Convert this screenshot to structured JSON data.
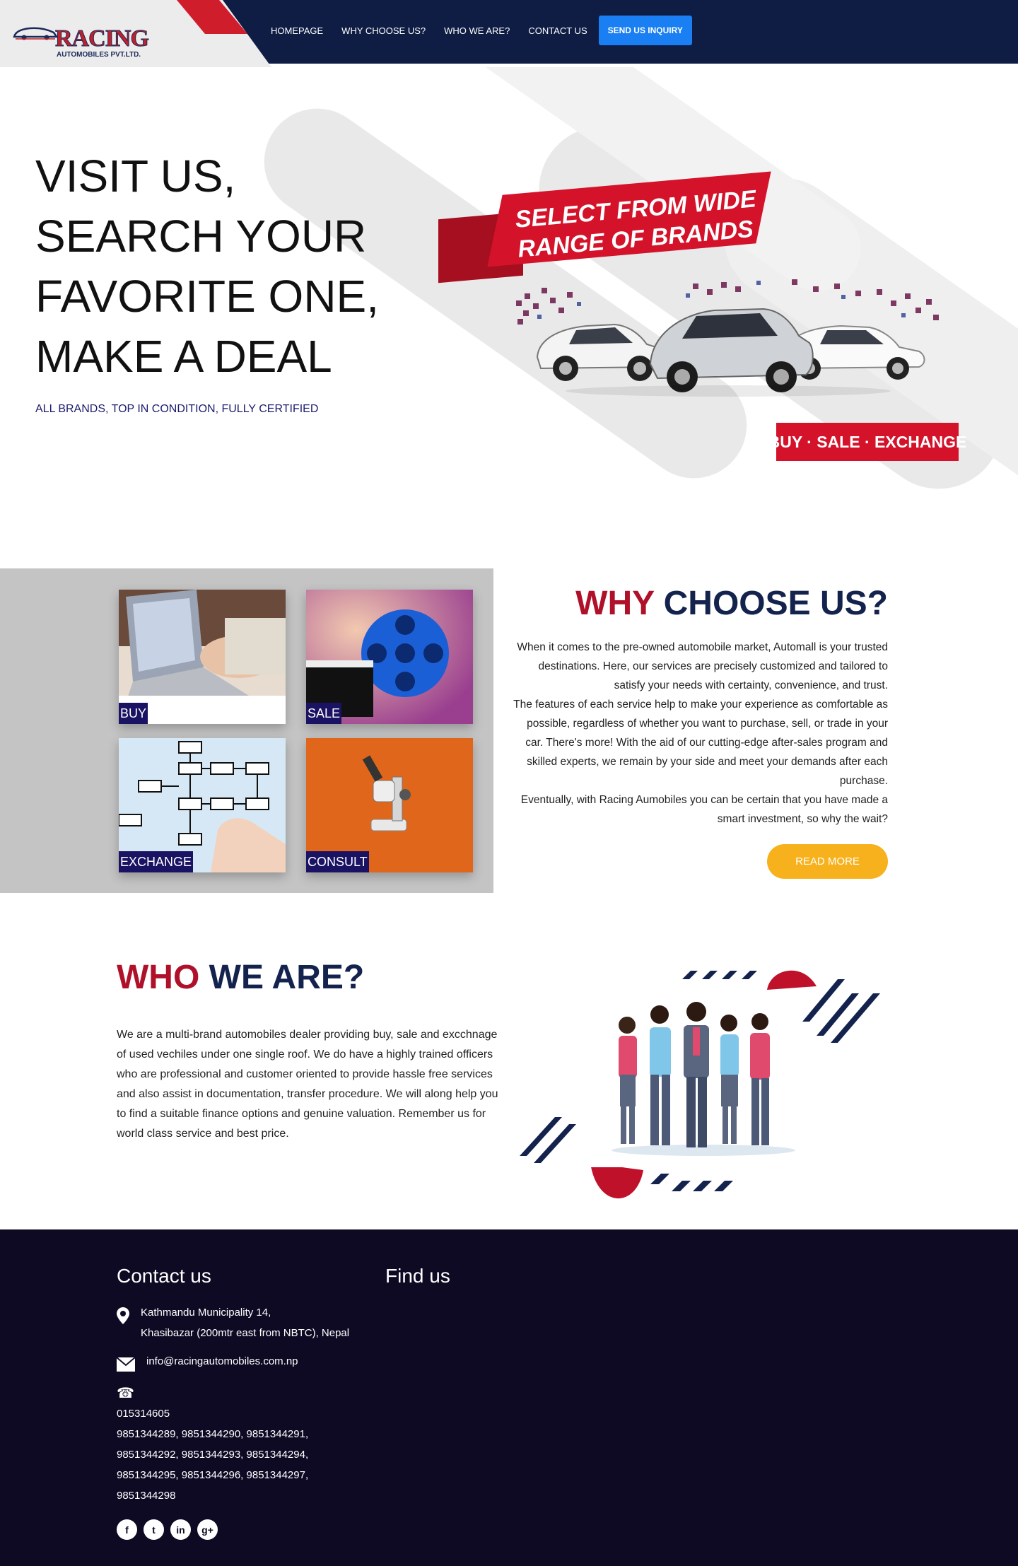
{
  "header": {
    "logo_text": "RACING",
    "logo_sub": "AUTOMOBILES PVT.LTD.",
    "nav": [
      "HOMEPAGE",
      "WHY CHOOSE US?",
      "WHO WE ARE?",
      "CONTACT US"
    ],
    "inquiry_label": "SEND US INQUIRY"
  },
  "hero": {
    "lines": [
      "VISIT US,",
      "SEARCH YOUR",
      "FAVORITE ONE,",
      "MAKE A DEAL"
    ],
    "subtitle": "ALL BRANDS, TOP IN CONDITION, FULLY CERTIFIED",
    "banner_line1": "SELECT FROM WIDE",
    "banner_line2": "RANGE OF BRANDS",
    "banner_tag": "BUY · SALE · EXCHANGE"
  },
  "why": {
    "title_red": "WHY",
    "title_navy": "CHOOSE US?",
    "tiles": [
      "BUY",
      "SALE",
      "EXCHANGE",
      "CONSULT"
    ],
    "paragraphs": [
      "When it comes to the pre-owned automobile market, Automall is your trusted destinations. Here, our services are precisely customized and tailored to satisfy your needs with certainty, convenience, and trust.",
      "The features of each service help to make your experience as comfortable as possible, regardless of whether you want to purchase, sell, or trade in your car. There's more! With the aid of our cutting-edge after-sales program and skilled experts, we remain by your side and meet your demands after each purchase.",
      "Eventually, with Racing Aumobiles you can be certain that you have made a smart investment, so why the wait?"
    ],
    "read_more": "READ MORE"
  },
  "who": {
    "title_red": "WHO",
    "title_navy": "WE ARE?",
    "text": "We are a multi-brand automobiles dealer providing buy, sale and excchnage of used vechiles under one single roof. We do have a highly trained officers who are professional and customer oriented to provide hassle free services and also assist in documentation, transfer procedure. We will along help you to find a suitable finance options and genuine valuation. Remember us for world class service and best price."
  },
  "footer": {
    "contact_heading": "Contact us",
    "find_heading": "Find us",
    "address_line1": "Kathmandu Municipality 14,",
    "address_line2": "Khasibazar (200mtr east from NBTC), Nepal",
    "email": "info@racingautomobiles.com.np",
    "phone_lines": [
      "015314605",
      "9851344289, 9851344290, 9851344291,",
      "9851344292, 9851344293, 9851344294,",
      "9851344295, 9851344296, 9851344297,",
      "9851344298"
    ],
    "socials": [
      "f",
      "t",
      "in",
      "g+"
    ]
  },
  "colors": {
    "navy": "#0f1d45",
    "red": "#b0112a",
    "accent_blue": "#1a7ff2",
    "button_yellow": "#f7b11d",
    "footer_bg": "#0f0a24"
  }
}
